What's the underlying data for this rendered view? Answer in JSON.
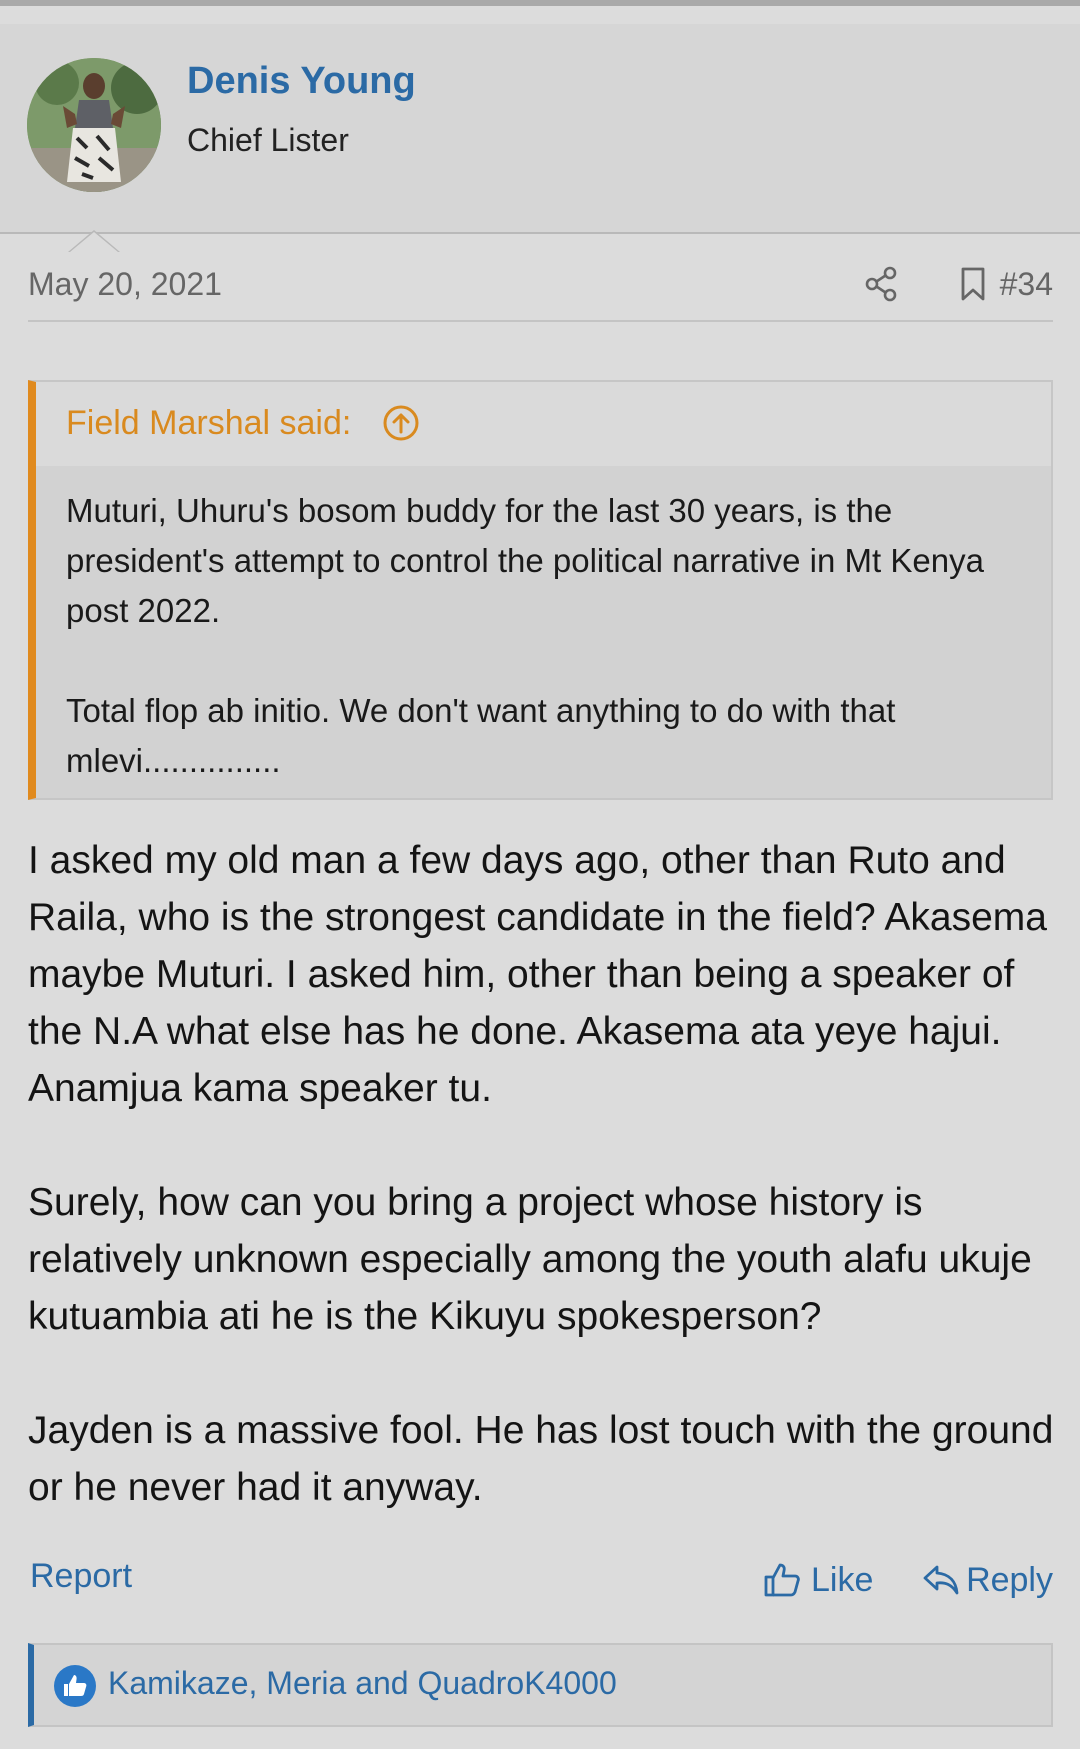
{
  "post": {
    "author": {
      "name": "Denis Young",
      "title": "Chief Lister",
      "avatar_icon": "user-avatar-photo"
    },
    "date": "May 20, 2021",
    "number": "#34",
    "quote": {
      "author_label": "Field Marshal said:",
      "paragraphs": [
        "Muturi, Uhuru's bosom buddy for the last 30 years, is the president's attempt to control the political narrative in Mt Kenya post 2022.",
        "Total flop ab initio. We don't want anything to do with that mlevi..............."
      ]
    },
    "body": [
      "I asked my old man a few days ago, other than Ruto and Raila, who is the strongest candidate in the field? Akasema maybe Muturi. I asked him, other than being a speaker of the N.A what else has he done. Akasema ata yeye hajui. Anamjua kama speaker tu.",
      "Surely, how can you bring a project whose history is relatively unknown especially among the youth alafu ukuje kutuambia ati he is the Kikuyu spokesperson?",
      "Jayden is a massive fool. He has lost touch with the ground or he never had it anyway."
    ],
    "actions": {
      "report": "Report",
      "like": "Like",
      "reply": "Reply"
    },
    "reactions": {
      "users": "Kamikaze, Meria and QuadroK4000",
      "icon": "thumbs-up-icon"
    }
  },
  "colors": {
    "link": "#2b6aa5",
    "quote_accent": "#e08a1e",
    "background": "#dcdcdc"
  }
}
